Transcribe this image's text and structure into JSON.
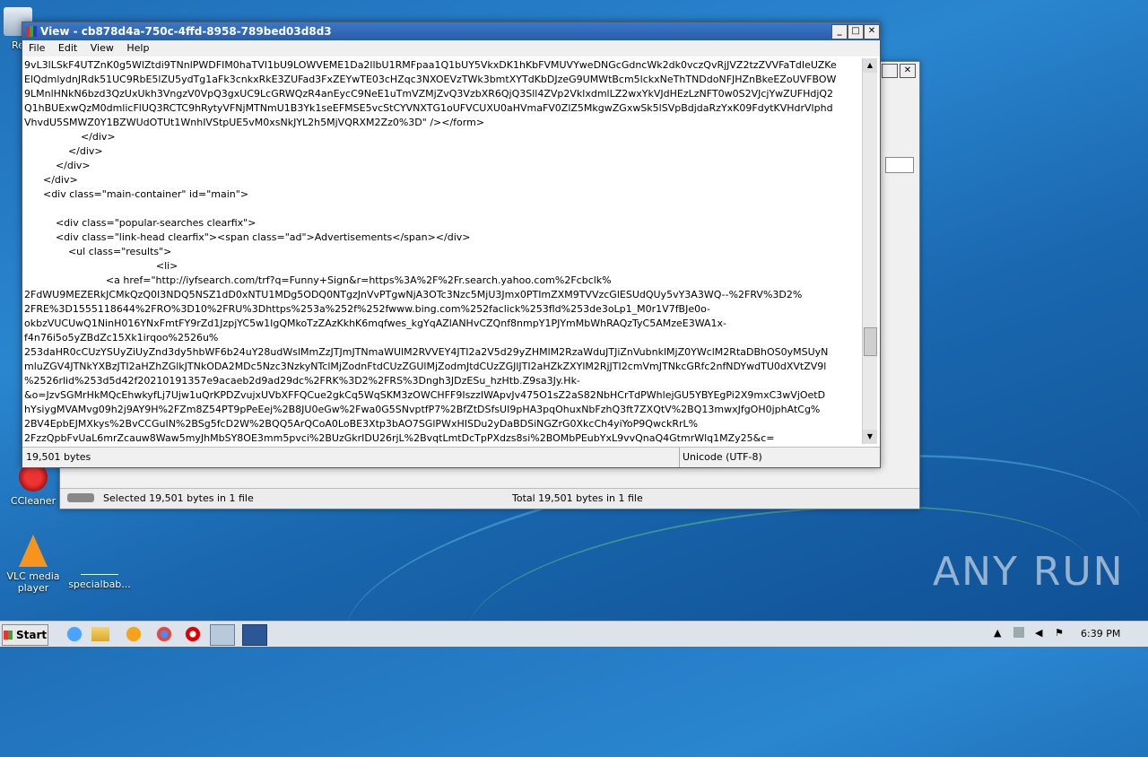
{
  "desktop": {
    "icons": [
      {
        "label": "Re"
      },
      {
        "label": "CCleaner"
      },
      {
        "label": "VLC media player"
      },
      {
        "label": "specialbab..."
      }
    ],
    "watermark": "ANY RUN"
  },
  "back_window": {
    "status_left": "Selected 19,501 bytes in 1 file",
    "status_right": "Total 19,501 bytes in 1 file"
  },
  "window": {
    "title": "View - cb878d4a-750c-4ffd-8958-789bed03d8d3",
    "menu": [
      "File",
      "Edit",
      "View",
      "Help"
    ],
    "content_lines": [
      "9vL3lLSkF4UTZnK0g5WlZtdi9TNnlPWDFIM0haTVI1bU9LOWVEME1Da2llbU1RMFpaa1Q1bUY5VkxDK1hKbFVMUVYweDNGcGdncWk2dk0vczQvRjJVZ2tzZVVFaTdIeUZKe",
      "ElQdmlydnJRdk51UC9RbE5lZU5ydTg1aFk3cnkxRkE3ZUFad3FxZEYwTE03cHZqc3NXOEVzTWk3bmtXYTdKbDJzeG9UMWtBcm5lckxNeThTNDdoNFJHZnBkeEZoUVFBOW",
      "9LMnlHNkN6bzd3QzUxUkh3VngzV0VpQ3gxUC9LcGRWQzR4anEycC9NeE1uTmVZMjZvQ3VzbXR6QjQ3Sll4ZVp2VklxdmlLZ2wxYkVJdHEzLzNFT0w0S2VJcjYwZUFHdjQ2",
      "Q1hBUExwQzM0dmlicFlUQ3RCTC9hRytyVFNjMTNmU1B3Yk1seEFMSE5vcStCYVNXTG1oUFVCUXU0aHVmaFV0ZlZ5MkgwZGxwSk5lSVpBdjdaRzYxK09FdytKVHdrVlphd",
      "VhvdU5SMWZ0Y1BZWUdOTUt1WnhIVStpUE5vM0xsNkJYL2h5MjVQRXM2Zz0%3D\" /></form>",
      "                  </div>",
      "              </div>",
      "          </div>",
      "      </div>",
      "      <div class=\"main-container\" id=\"main\">",
      "",
      "          <div class=\"popular-searches clearfix\">",
      "          <div class=\"link-head clearfix\"><span class=\"ad\">Advertisements</span></div>",
      "              <ul class=\"results\">",
      "                                          <li>",
      "                          <a href=\"http://iyfsearch.com/trf?q=Funny+Sign&r=https%3A%2F%2Fr.search.yahoo.com%2Fcbclk%",
      "2FdWU9MEZERkJCMkQzQ0I3NDQ5NSZ1dD0xNTU1MDg5ODQ0NTgzJnVvPTgwNjA3OTc3Nzc5MjU3Jmx0PTImZXM9TVVzcGlESUdQUy5vY3A3WQ--%2FRV%3D2%",
      "2FRE%3D1555118644%2FRO%3D10%2FRU%3Dhttps%253a%252f%252fwww.bing.com%252faclick%253fld%253de3oLp1_M0r1V7fBJe0o-",
      "okbzVUCUwQ1NinH016YNxFmtFY9rZd1JzpjYC5w1IgQMkoTzZAzKkhK6mqfwes_kgYqAZlANHvCZQnf8nmpY1PJYmMbWhRAQzTyC5AMzeE3WA1x-",
      "f4n76i5o5yZBdZc15Xk1irqoo%2526u%",
      "253daHR0cCUzYSUyZiUyZnd3dy5hbWF6b24uY28udWslMmZzJTJmJTNmaWUlM2RVVEY4JTI2a2V5d29yZHMlM2RzaWduJTJiZnVubnklMjZ0YWclM2RtaDBhOS0yMSUyN",
      "mluZGV4JTNkYXBzJTI2aHZhZGlkJTNkODA2MDc5Nzc3NzkyNTclMjZodnFtdCUzZGUlMjZodmJtdCUzZGJlJTI2aHZkZXYlM2RjJTI2cmVmJTNkcGRfc2nfNDYwdTU0dXVtZV9l",
      "%2526rlid%253d5d42f20210191357e9acaeb2d9ad29dc%2FRK%3D2%2FRS%3Dngh3JDzESu_hzHtb.Z9sa3Jy.Hk-",
      "&o=JzvSGMrHkMQcEhwkyfLj7Ujw1uQrKPDZvujxUVbXFFQCue2gkCq5WqSKM3zOWCHFF9IszzIWApvJv475O1sZ2aS82NbHCrTdPWhlejGU5YBYEgPi2X9mxC3wVjOetD",
      "hYsiygMVAMvg09h2j9AY9H%2FZm8Z54PT9pPeEej%2B8JU0eGw%2Fwa0G5SNvptfP7%2BfZtDSfsUI9pHA3pqOhuxNbFzhQ3ft7ZXQtV%2BQ13mwxJfgOH0jphAtCg%",
      "2BV4EpbEJMXkys%2BvCCGuIN%2BSg5fcD2W%2BQQ5ArQCoA0LoBE3Xtp3bAO7SGlPWxHISDu2yDaBDSiNGZrG0XkcCh4yiYoP9QwckRrL%",
      "2FzzQpbFvUaL6mrZcauw8Waw5myJhMbSY8OE3mm5pvci%2BUzGkrIDU26rjL%2BvqtLmtDcTpPXdzs8si%2BOMbPEubYxL9vvQnaQ4GtmrWlq1MZy25&c="
    ],
    "status_left": "19,501 bytes",
    "status_right": "Unicode (UTF-8)"
  },
  "taskbar": {
    "start_label": "Start",
    "clock": "6:39 PM"
  }
}
